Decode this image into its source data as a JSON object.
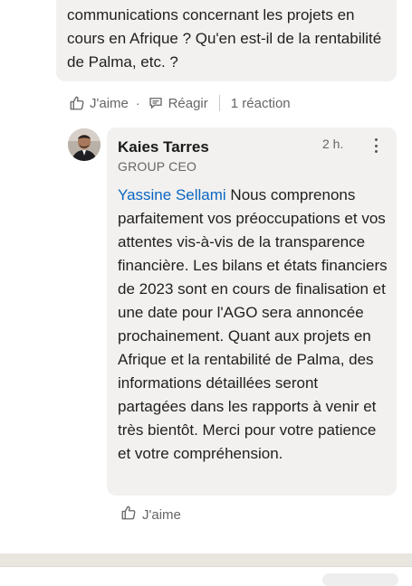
{
  "parent_comment": {
    "text": "communications concernant les projets en cours en Afrique ? Qu'en est-il de la rentabilité de Palma, etc. ?"
  },
  "parent_actions": {
    "like_label": "J'aime",
    "dot": "·",
    "reply_label": "Réagir",
    "reactions_count": "1 réaction"
  },
  "reply": {
    "author": "Kaies Tarres",
    "headline": "GROUP CEO",
    "time": "2 h.",
    "mention": "Yassine Sellami",
    "text": " Nous comprenons parfaitement vos préoccupations et vos attentes vis-à-vis de la transparence financière. Les bilans et états financiers de 2023 sont en cours de finalisation et une date pour l'AGO sera annoncée prochainement. Quant aux projets en Afrique et la rentabilité de Palma, des informations détaillées seront partagées dans les rapports à venir et très bientôt. Merci pour votre patience et votre compréhension.",
    "like_label": "J'aime"
  },
  "icons": {
    "like": "thumbs-up-icon",
    "reply": "speech-bubble-icon",
    "more": "more-vertical-icon"
  },
  "colors": {
    "bubble": "#f2f1ef",
    "mention": "#0a66c2",
    "muted": "#666666"
  }
}
